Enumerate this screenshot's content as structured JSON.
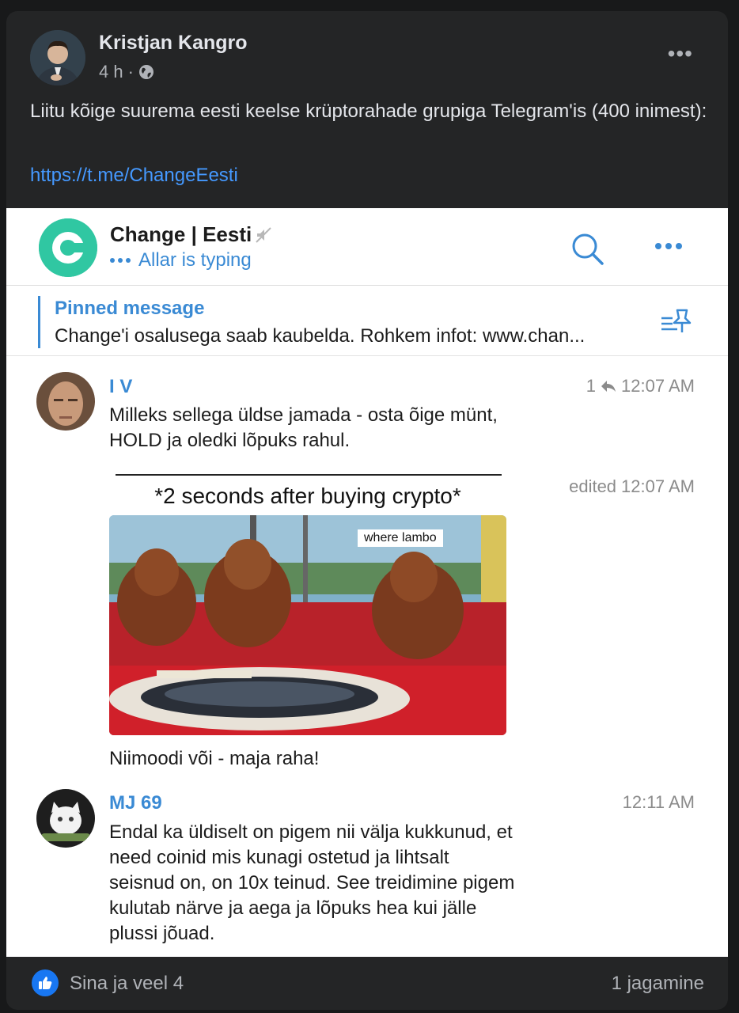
{
  "post": {
    "author_name": "Kristjan Kangro",
    "time": "4 h",
    "separator": "·",
    "privacy_icon": "globe-icon",
    "more_icon": "more-horizontal-icon",
    "text": "Liitu kõige suurema eesti keelse krüptorahade grupiga Telegram'is (400 inimest):",
    "link": "https://t.me/ChangeEesti"
  },
  "telegram": {
    "chat_title": "Change | Eesti",
    "status": "Allar is typing",
    "pinned_title": "Pinned message",
    "pinned_text": "Change'i osalusega saab kaubelda. Rohkem infot: www.chan...",
    "accent_color": "#3a8ad4",
    "logo_color": "#30c7a2",
    "logo_letter": "C",
    "messages": [
      {
        "name": "I V",
        "reply_count": "1",
        "time": "12:07 AM",
        "text_lines": [
          "Milleks sellega üldse jamada - osta õige münt,",
          "HOLD ja oledki lõpuks rahul."
        ]
      },
      {
        "edited": "edited",
        "time": "12:07 AM",
        "meme_caption": "*2 seconds after buying crypto*",
        "meme_sign": "where lambo",
        "text": "Niimoodi või - maja raha!"
      },
      {
        "name": "MJ 69",
        "time": "12:11 AM",
        "text_lines": [
          "Endal ka üldiselt on pigem nii välja kukkunud, et",
          "need coinid mis kunagi ostetud ja lihtsalt",
          "seisnud on, on 10x teinud. See treidimine pigem",
          "kulutab närve ja aega ja lõpuks hea kui jälle",
          "plussi jõuad."
        ]
      }
    ]
  },
  "footer": {
    "reactions": "Sina ja veel 4",
    "shares": "1 jagamine",
    "like_color": "#1877f2"
  }
}
